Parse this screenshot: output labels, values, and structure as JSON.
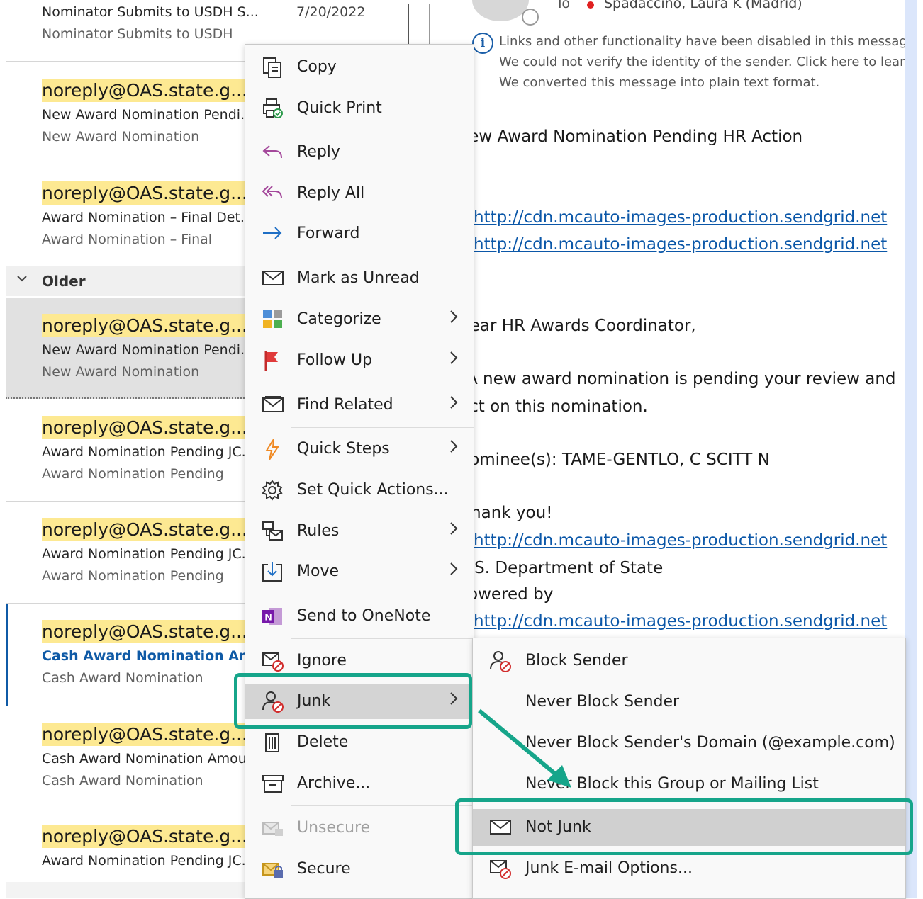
{
  "message_list": {
    "top_item": {
      "sender": "Nominator Submits to USDH S...",
      "date": "7/20/2022",
      "preview": "Nominator Submits to USDH"
    },
    "items_before_group": [
      {
        "sender": "noreply@OAS.state.g...",
        "subject": "New Award Nomination Pendi...",
        "preview": "New Award Nomination"
      },
      {
        "sender": "noreply@OAS.state.g...",
        "subject": "Award Nomination – Final Det...",
        "preview": "Award Nomination – Final"
      }
    ],
    "group_label": "Older",
    "items_after_group": [
      {
        "sender": "noreply@OAS.state.g...",
        "subject": "New Award Nomination Pendi...",
        "preview": "New Award Nomination"
      },
      {
        "sender": "noreply@OAS.state.g...",
        "subject": "Award Nomination Pending JC...",
        "preview": "Award Nomination Pending"
      },
      {
        "sender": "noreply@OAS.state.g...",
        "subject": "Award Nomination Pending JC...",
        "preview": "Award Nomination Pending"
      },
      {
        "sender": "noreply@OAS.state.g...",
        "subject": "Cash Award Nomination Am...",
        "preview": "Cash Award Nomination"
      },
      {
        "sender": "noreply@OAS.state.g...",
        "subject": "Cash Award Nomination Amou...",
        "preview": "Cash Award Nomination"
      },
      {
        "sender": "noreply@OAS.state.g...",
        "subject": "Award Nomination Pending JC...",
        "preview": ""
      }
    ]
  },
  "reading_pane": {
    "to_label": "To",
    "to_name": "Spadaccino, Laura K (Madrid)",
    "info_lines": [
      "Links and other functionality have been disabled in this message.",
      "We could not verify the identity of the sender. Click here to learn more.",
      "We converted this message into plain text format."
    ],
    "title": "New Award Nomination Pending HR Action",
    "link": "http://cdn.mcauto-images-production.sendgrid.net",
    "greeting": "Dear HR Awards Coordinator,",
    "body_line1": "A new award nomination is pending your review and",
    "body_line2": "act on this nomination.",
    "nominee": "Nominee(s): TAME-GENTLO, C SCITT N",
    "thanks": "Thank you!",
    "department": "U.S. Department of State",
    "powered_by": "Powered by"
  },
  "context_menu": {
    "items": [
      {
        "label": "Copy",
        "icon": "copy-icon"
      },
      {
        "label": "Quick Print",
        "icon": "quick-print-icon"
      },
      {
        "label": "Reply",
        "icon": "reply-icon"
      },
      {
        "label": "Reply All",
        "icon": "reply-all-icon"
      },
      {
        "label": "Forward",
        "icon": "forward-icon"
      },
      {
        "label": "Mark as Unread",
        "icon": "envelope-icon"
      },
      {
        "label": "Categorize",
        "icon": "categorize-icon"
      },
      {
        "label": "Follow Up",
        "icon": "flag-icon"
      },
      {
        "label": "Find Related",
        "icon": "find-related-icon"
      },
      {
        "label": "Quick Steps",
        "icon": "lightning-icon"
      },
      {
        "label": "Set Quick Actions...",
        "icon": "gear-icon"
      },
      {
        "label": "Rules",
        "icon": "rules-icon"
      },
      {
        "label": "Move",
        "icon": "move-icon"
      },
      {
        "label": "Send to OneNote",
        "icon": "onenote-icon"
      },
      {
        "label": "Ignore",
        "icon": "ignore-icon"
      },
      {
        "label": "Junk",
        "icon": "junk-icon"
      },
      {
        "label": "Delete",
        "icon": "trash-icon"
      },
      {
        "label": "Archive...",
        "icon": "archive-icon"
      },
      {
        "label": "Unsecure",
        "icon": "unsecure-icon"
      },
      {
        "label": "Secure",
        "icon": "secure-icon"
      }
    ]
  },
  "junk_submenu": {
    "items": [
      {
        "label": "Block Sender",
        "icon": "block-sender-icon"
      },
      {
        "label": "Never Block Sender",
        "icon": ""
      },
      {
        "label": "Never Block Sender's Domain (@example.com)",
        "icon": ""
      },
      {
        "label": "Never Block this Group or Mailing List",
        "icon": ""
      },
      {
        "label": "Not Junk",
        "icon": "envelope-icon"
      },
      {
        "label": "Junk E-mail Options...",
        "icon": "junk-options-icon"
      }
    ]
  },
  "colors": {
    "sender_highlight": "#fde992",
    "callout": "#16a58a",
    "link": "#0b57a8",
    "unread_subject": "#0f5aa6"
  }
}
